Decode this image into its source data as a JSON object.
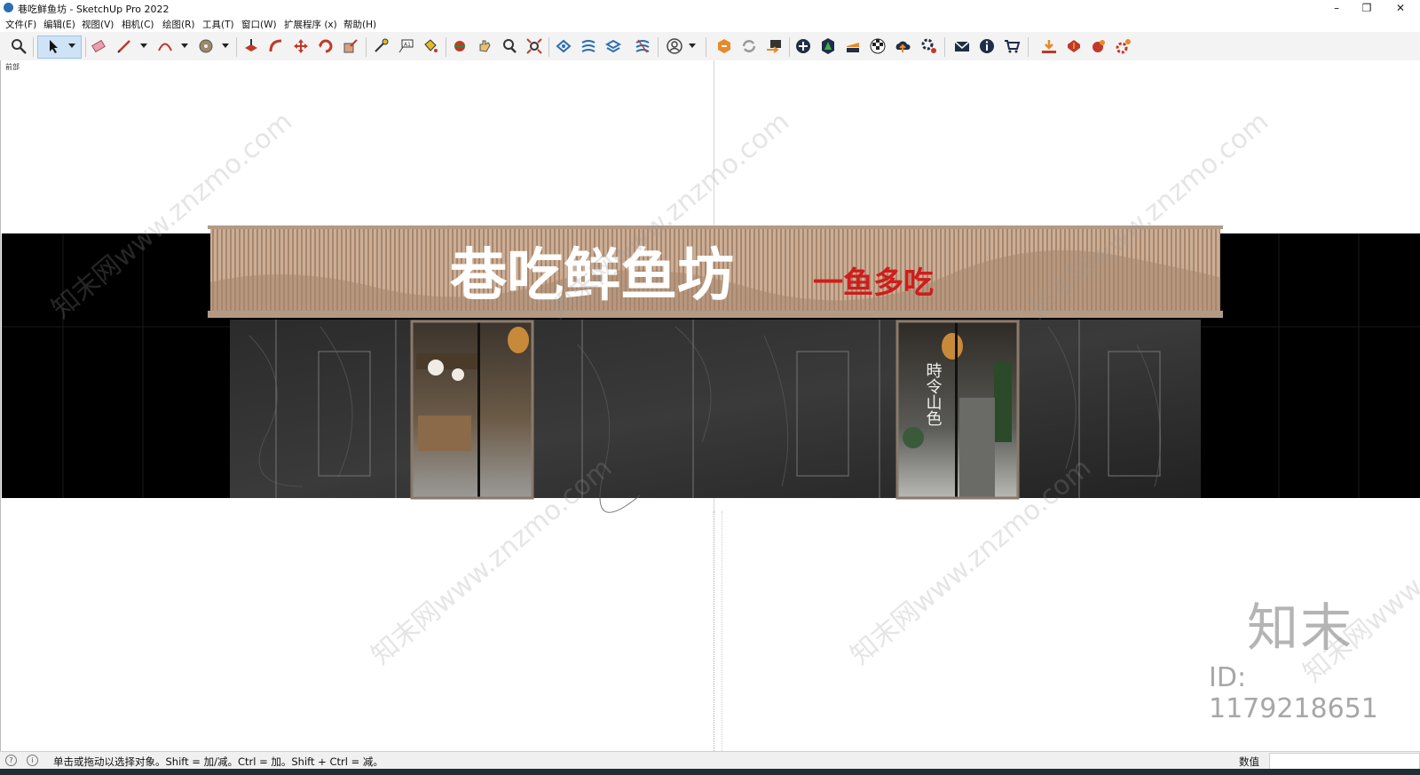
{
  "window": {
    "title": "巷吃鲜鱼坊 - SketchUp Pro 2022",
    "minimize": "–",
    "restore": "❐",
    "close": "✕"
  },
  "menu": [
    "文件(F)",
    "编辑(E)",
    "视图(V)",
    "相机(C)",
    "绘图(R)",
    "工具(T)",
    "窗口(W)",
    "扩展程序 (x)",
    "帮助(H)"
  ],
  "toolbar_icons": [
    "zoom-icon",
    "select-icon",
    "eraser-icon",
    "pencil-icon",
    "arc-icon",
    "tape-icon",
    "push-pull-icon",
    "follow-me-icon",
    "move-icon",
    "rotate-icon",
    "scale-icon",
    "tape-measure-icon",
    "text-icon",
    "paint-bucket-icon",
    "orbit-icon",
    "pan-icon",
    "zoom-tool-icon",
    "zoom-extents-icon",
    "sandbox-icon",
    "smoove-icon",
    "stamp-icon",
    "drape-icon",
    "account-icon",
    "extension-warehouse-icon",
    "refresh-icon",
    "send-layout-icon",
    "add-location-icon",
    "3d-warehouse-icon",
    "layers-icon",
    "checker-icon",
    "upload-cloud-icon",
    "gear-icon",
    "mail-icon",
    "info-icon",
    "cart-icon",
    "import-icon",
    "export-icon",
    "plugin-icon",
    "settings-icon"
  ],
  "viewport": {
    "scene_label": "前部",
    "signboard": {
      "name": "巷吃鲜鱼坊",
      "slogan": "一鱼多吃"
    },
    "door_art": "時令山色",
    "watermark": "知末网www.znzmo.com",
    "logo": "知末",
    "id_text": "ID: 1179218651"
  },
  "status": {
    "hint": "单击或拖动以选择对象。Shift = 加/减。Ctrl = 加。Shift + Ctrl = 减。",
    "value_label": "数值",
    "value": ""
  },
  "colors": {
    "fascia": "#c9a98f",
    "slogan": "#d01c1c",
    "marble": "#2a2a2a"
  }
}
